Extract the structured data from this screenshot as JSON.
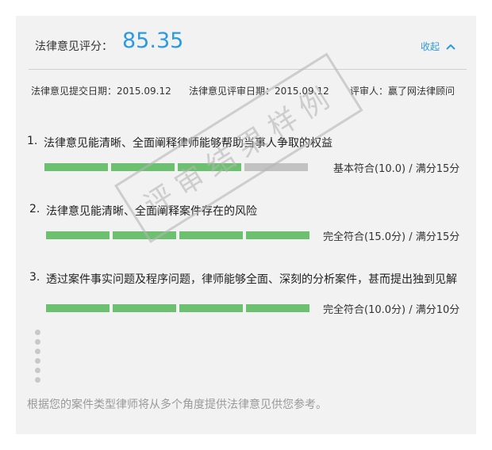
{
  "header": {
    "score_label": "法律意见评分：",
    "score_value": "85.35",
    "collapse_label": "收起"
  },
  "meta": {
    "submit_date": "法律意见提交日期：2015.09.12",
    "review_date": "法律意见评审日期：2015.09.12",
    "reviewer": "评审人：赢了网法律顾问"
  },
  "items": [
    {
      "number": "1.",
      "title": "法律意见能清晰、全面阐释律师能够帮助当事人争取的权益",
      "score_text": "基本符合(10.0) / 满分15分",
      "filled_segments": 3,
      "total_segments": 4
    },
    {
      "number": "2.",
      "title": "法律意见能清晰、全面阐释案件存在的风险",
      "score_text": "完全符合(15.0分) / 满分15分",
      "filled_segments": 4,
      "total_segments": 4
    },
    {
      "number": "3.",
      "title": "透过案件事实问题及程序问题，律师能够全面、深刻的分析案件，甚而提出独到见解",
      "score_text": "完全符合(10.0分) / 满分10分",
      "filled_segments": 4,
      "total_segments": 4
    }
  ],
  "footer": {
    "text": "根据您的案件类型律师将从多个角度提供法律意见供您参考。"
  },
  "watermark": {
    "text": "评审结果样例"
  },
  "colors": {
    "accent": "#2b9be0",
    "bar_fill": "#6cc070",
    "bar_empty": "#c2c2c2"
  },
  "icons": {
    "collapse": "chevron-up-icon",
    "more": "vertical-dots-icon"
  }
}
